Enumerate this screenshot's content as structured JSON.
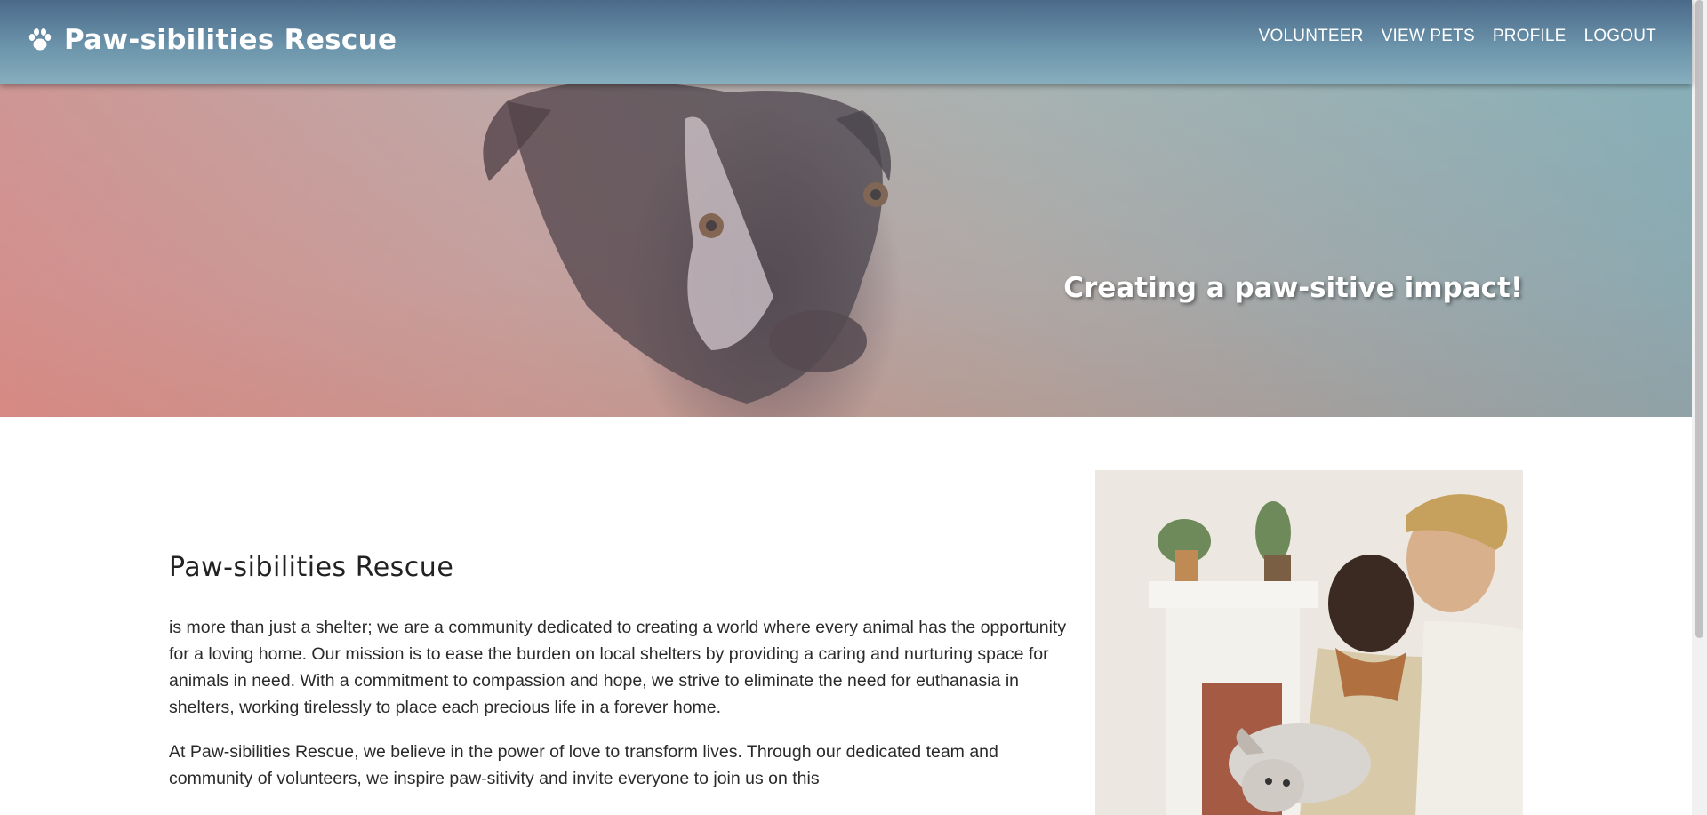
{
  "navbar": {
    "brand": "Paw-sibilities Rescue",
    "brand_icon": "paw-icon",
    "links": [
      {
        "label": "VOLUNTEER"
      },
      {
        "label": "VIEW PETS"
      },
      {
        "label": "PROFILE"
      },
      {
        "label": "LOGOUT"
      }
    ]
  },
  "hero": {
    "tagline": "Creating a paw-sitive impact!"
  },
  "about": {
    "title": "Paw-sibilities Rescue",
    "paragraphs": [
      "is more than just a shelter; we are a community dedicated to creating a world where every animal has the opportunity for a loving home. Our mission is to ease the burden on local shelters by providing a caring and nurturing space for animals in need. With a commitment to compassion and hope, we strive to eliminate the need for euthanasia in shelters, working tirelessly to place each precious life in a forever home.",
      "At Paw-sibilities Rescue, we believe in the power of love to transform lives. Through our dedicated team and community of volunteers, we inspire paw-sitivity and invite everyone to join us on this"
    ]
  }
}
